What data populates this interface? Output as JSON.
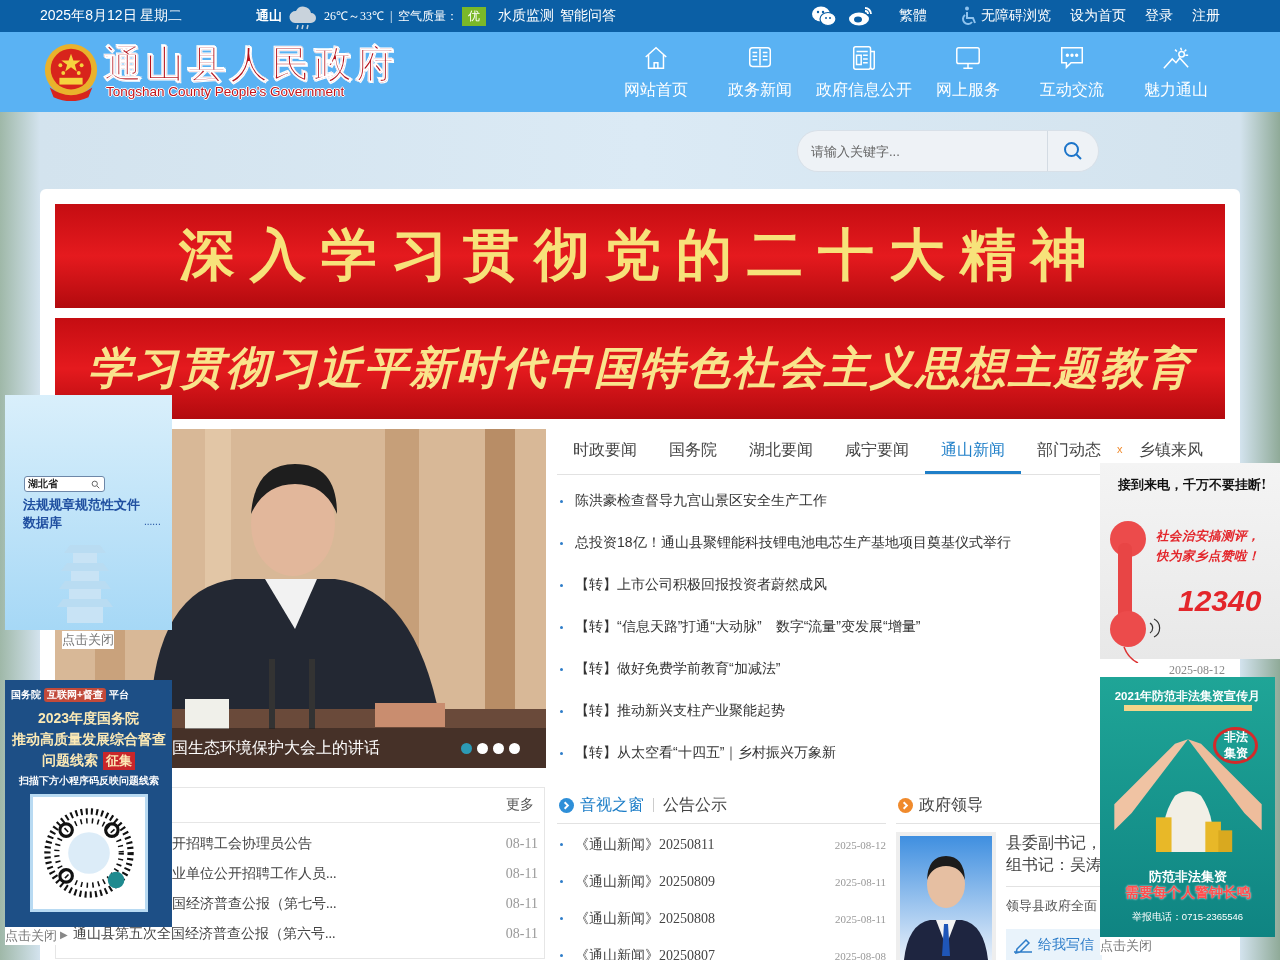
{
  "top_bar": {
    "date": "2025年8月12日 星期二",
    "city": "通山",
    "temperature": "26℃～33℃",
    "separator": "|",
    "air_label": "空气质量：",
    "air_quality": "优",
    "links": [
      "水质监测",
      "智能问答"
    ],
    "language": "繁體",
    "accessibility": "无障碍浏览",
    "right_links": [
      "设为首页",
      "登录",
      "注册"
    ]
  },
  "header": {
    "title": "通山县人民政府",
    "subtitle": "Tongshan County People's Government",
    "nav": [
      {
        "label": "网站首页"
      },
      {
        "label": "政务新闻"
      },
      {
        "label": "政府信息公开"
      },
      {
        "label": "网上服务"
      },
      {
        "label": "互动交流"
      },
      {
        "label": "魅力通山"
      }
    ]
  },
  "search": {
    "placeholder": "请输入关键字..."
  },
  "banners": [
    {
      "text": "深入学习贯彻党的二十大精神",
      "kind": "block"
    },
    {
      "text": "学习贯彻习近平新时代中国特色社会主义思想主题教育",
      "kind": "script"
    }
  ],
  "slideshow": {
    "caption": "国生态环境保护大会上的讲话",
    "dots": [
      {
        "selected": true
      },
      {
        "selected": false
      },
      {
        "selected": false
      },
      {
        "selected": false
      }
    ]
  },
  "news": {
    "tabs": [
      {
        "label": "时政要闻",
        "selected": false
      },
      {
        "label": "国务院",
        "selected": false
      },
      {
        "label": "湖北要闻",
        "selected": false
      },
      {
        "label": "咸宁要闻",
        "selected": false
      },
      {
        "label": "通山新闻",
        "selected": true
      },
      {
        "label": "部门动态",
        "selected": false
      },
      {
        "label": "乡镇来风",
        "selected": false
      }
    ],
    "close_mark": "x",
    "items": [
      {
        "title": "陈洪豪检查督导九宫山景区安全生产工作"
      },
      {
        "title": "总投资18亿！通山县聚锂能科技锂电池电芯生产基地项目奠基仪式举行"
      },
      {
        "title": "【转】上市公司积极回报投资者蔚然成风"
      },
      {
        "title": "【转】“信息天路”打通“大动脉”　数字“流量”变发展“增量”"
      },
      {
        "title": "【转】做好免费学前教育“加减法”",
        "date": "2025-08-12"
      },
      {
        "title": "【转】推动新兴支柱产业聚能起势"
      },
      {
        "title": "【转】从太空看“十四五”｜乡村振兴万象新"
      }
    ]
  },
  "notices": {
    "more": "更多",
    "items": [
      {
        "kind": "partial",
        "title": "开招聘工会协理员公告",
        "date": "08-11"
      },
      {
        "kind": "partial",
        "title": "业单位公开招聘工作人员...",
        "date": "08-11"
      },
      {
        "kind": "partial",
        "title": "国经济普查公报（第七号...",
        "date": "08-11"
      },
      {
        "kind": "full",
        "marker": "▶",
        "title": "通山县第五次全国经济普查公报（第六号...",
        "date": "08-11"
      }
    ]
  },
  "media": {
    "tabs": [
      {
        "label": "音视之窗",
        "selected": true
      },
      {
        "label": "公告公示",
        "selected": false
      }
    ],
    "items": [
      {
        "title": "《通山新闻》20250811",
        "date": "2025-08-12"
      },
      {
        "title": "《通山新闻》20250809",
        "date": "2025-08-11"
      },
      {
        "title": "《通山新闻》20250808",
        "date": "2025-08-11"
      },
      {
        "title": "《通山新闻》20250807",
        "date": "2025-08-08"
      }
    ]
  },
  "leaders": {
    "title": "政府领导",
    "role": [
      "县委副书记，",
      "组书记：吴涛"
    ],
    "duty": "领导县政府全面",
    "write_button": "给我写信"
  },
  "ad_regulations": {
    "province": "湖北省",
    "title": "法规规章规范性文件数据库",
    "ellipsis": "......",
    "close": "点击关闭"
  },
  "ad_inspection": {
    "lead": "国务院",
    "badge": "互联网+督查",
    "tail": "平台",
    "lines": [
      "2023年度国务院",
      "推动高质量发展综合督查"
    ],
    "topic": "问题线索",
    "tag": "征集",
    "scan": "扫描下方小程序码反映问题线索",
    "close": "点击关闭"
  },
  "ad_hotline": {
    "headline": "接到来电，千万不要挂断!",
    "slogan": [
      "社会治安搞测评，",
      "快为家乡点赞啦！"
    ],
    "number": "12340"
  },
  "ad_fundraising": {
    "title": "2021年防范非法集资宣传月",
    "sign": "非法集资",
    "lines": [
      "防范非法集资",
      "需要每个人警钟长鸣"
    ],
    "phone": "举报电话：0715-2365546",
    "close": "点击关闭"
  }
}
